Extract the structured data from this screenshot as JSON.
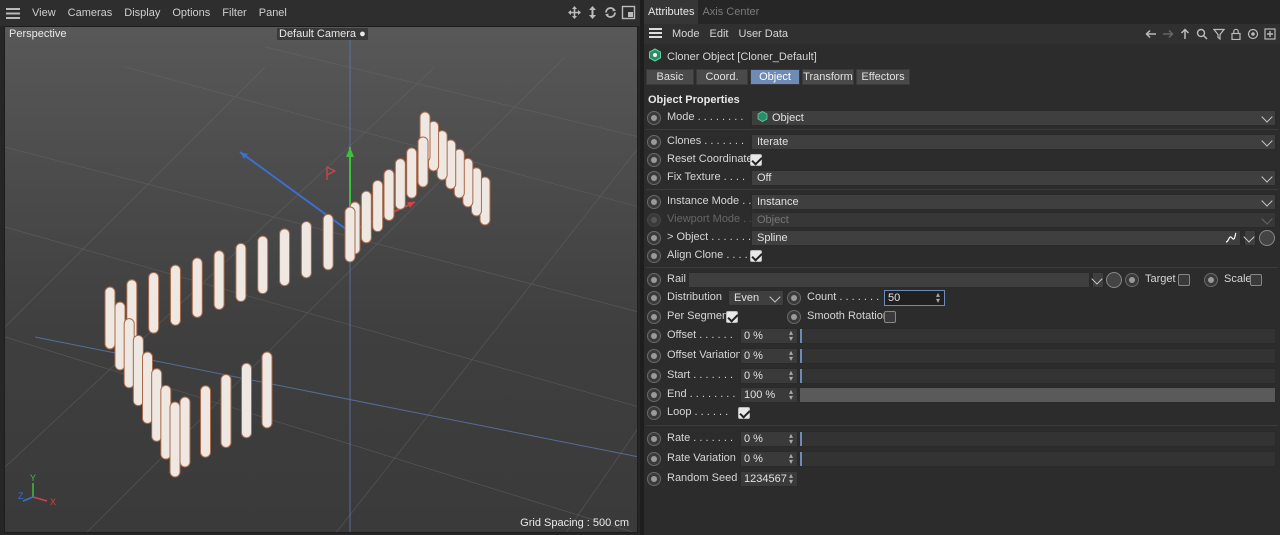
{
  "viewport": {
    "menu": [
      "View",
      "Cameras",
      "Display",
      "Options",
      "Filter",
      "Panel"
    ],
    "projection": "Perspective",
    "camera": "Default Camera",
    "grid_spacing": "Grid Spacing : 500 cm",
    "axis_labels": {
      "x": "X",
      "y": "Y",
      "z": "Z"
    }
  },
  "attributes": {
    "tabs": [
      "Attributes",
      "Axis Center"
    ],
    "menu": [
      "Mode",
      "Edit",
      "User Data"
    ],
    "object_title": "Cloner Object [Cloner_Default]",
    "subtabs": [
      "Basic",
      "Coord.",
      "Object",
      "Transform",
      "Effectors"
    ],
    "active_subtab": "Object",
    "section": "Object Properties",
    "rows": {
      "mode": {
        "label": "Mode . . . . . . . .",
        "value": "Object"
      },
      "clones": {
        "label": "Clones . . . . . . .",
        "value": "Iterate"
      },
      "reset_coordinates": {
        "label": "Reset Coordinates",
        "checked": true
      },
      "fix_texture": {
        "label": "Fix Texture . . . .",
        "value": "Off"
      },
      "instance_mode": {
        "label": "Instance Mode . .",
        "value": "Instance"
      },
      "viewport_mode": {
        "label": "Viewport Mode . .",
        "value": "Object"
      },
      "object": {
        "label": "Object . . . . . . .",
        "value": "Spline"
      },
      "align_clone": {
        "label": "Align Clone . . . .",
        "checked": true
      },
      "rail": {
        "label": "Rail",
        "value": ""
      },
      "target": {
        "label": "Target",
        "checked": false
      },
      "scale": {
        "label": "Scale",
        "checked": false
      },
      "distribution": {
        "label": "Distribution",
        "value": "Even"
      },
      "count": {
        "label": "Count . . . . . . .",
        "value": "50"
      },
      "per_segment": {
        "label": "Per Segment",
        "checked": true
      },
      "smooth_rotation": {
        "label": "Smooth Rotation",
        "checked": false
      },
      "offset": {
        "label": "Offset . . . . . .",
        "value": "0 %",
        "level": 0
      },
      "offset_variation": {
        "label": "Offset Variation",
        "value": "0 %",
        "level": 0
      },
      "start": {
        "label": "Start . . . . . . .",
        "value": "0 %",
        "level": 0
      },
      "end": {
        "label": "End . . . . . . . .",
        "value": "100 %",
        "level": 1
      },
      "loop": {
        "label": "Loop . . . . . .",
        "checked": true
      },
      "rate": {
        "label": "Rate . . . . . . .",
        "value": "0 %",
        "level": 0
      },
      "rate_variation": {
        "label": "Rate Variation",
        "value": "0 %",
        "level": 0
      },
      "random_seed": {
        "label": "Random Seed",
        "value": "1234567"
      }
    }
  }
}
